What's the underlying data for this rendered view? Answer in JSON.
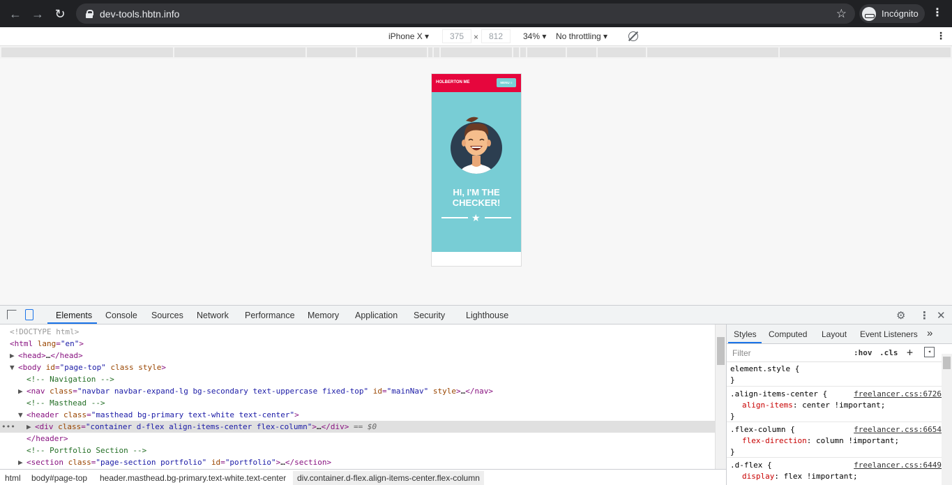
{
  "browser": {
    "url": "dev-tools.hbtn.info",
    "profile_label": "Incógnito"
  },
  "device_toolbar": {
    "device": "iPhone X",
    "width": "375",
    "height": "812",
    "zoom": "34%",
    "throttling": "No throttling"
  },
  "site": {
    "brand": "HOLBERTON ME",
    "menu_label": "MENU ≡",
    "hero_title_line1": "HI, I'M THE",
    "hero_title_line2": "CHECKER!",
    "colors": {
      "nav": "#e6063d",
      "masthead": "#78cdd5"
    }
  },
  "devtools": {
    "tabs": [
      "Elements",
      "Console",
      "Sources",
      "Network",
      "Performance",
      "Memory",
      "Application",
      "Security",
      "Lighthouse"
    ],
    "dom_selected_suffix": "== $0",
    "breadcrumbs": [
      "html",
      "body#page-top",
      "header.masthead.bg-primary.text-white.text-center",
      "div.container.d-flex.align-items-center.flex-column"
    ],
    "styles_tabs": [
      "Styles",
      "Computed",
      "Layout",
      "Event Listeners"
    ],
    "filter_placeholder": "Filter",
    "hov": ":hov",
    "cls": ".cls",
    "rules": [
      {
        "selector": "element.style {",
        "source": "",
        "prop": "",
        "value": ""
      },
      {
        "selector": ".align-items-center {",
        "source": "freelancer.css:6726",
        "prop": "align-items",
        "value": "center !important;"
      },
      {
        "selector": ".flex-column {",
        "source": "freelancer.css:6654",
        "prop": "flex-direction",
        "value": "column !important;"
      },
      {
        "selector": ".d-flex {",
        "source": "freelancer.css:6449",
        "prop": "display",
        "value": "flex !important;"
      }
    ]
  }
}
